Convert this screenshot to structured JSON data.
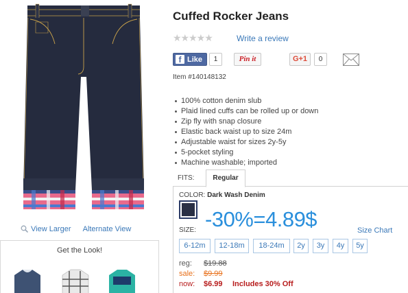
{
  "gallery": {
    "view_larger": "View Larger",
    "alternate_view": "Alternate View",
    "get_the_look": "Get the Look!"
  },
  "product": {
    "title": "Cuffed Rocker Jeans",
    "rating_stars": "★★★★★",
    "write_review": "Write a review",
    "item_number": "Item #140148132",
    "features": [
      "100% cotton denim slub",
      "Plaid lined cuffs can be rolled up or down",
      "Zip fly with snap closure",
      "Elastic back waist up to size 24m",
      "Adjustable waist for sizes 2y-5y",
      "5-pocket styling",
      "Machine washable; imported"
    ]
  },
  "social": {
    "fb_like": "Like",
    "fb_icon": "f",
    "fb_count": "1",
    "pinit": "Pin it",
    "gplus": "G+1",
    "gplus_count": "0",
    "email_icon": "envelope-icon"
  },
  "fits": {
    "label": "FITS:",
    "tabs": [
      "Regular"
    ]
  },
  "options": {
    "color_label": "COLOR:",
    "color_value": "Dark Wash Denim",
    "size_label": "SIZE:",
    "promo_text": "-30%=4.89$",
    "size_chart": "Size Chart",
    "sizes": [
      "6-12m",
      "12-18m",
      "18-24m",
      "2y",
      "3y",
      "4y",
      "5y"
    ]
  },
  "pricing": {
    "reg_label": "reg:",
    "reg_value": "$19.88",
    "sale_label": "sale:",
    "sale_value": "$9.99",
    "now_label": "now:",
    "now_value": "$6.99",
    "now_note": "Includes 30% Off"
  },
  "colors": {
    "link": "#3a78b8",
    "promo": "#2a8fdc",
    "sale": "#e8701a",
    "now": "#b71c1c",
    "facebook": "#4e69a2",
    "denim": "#2a3044"
  }
}
